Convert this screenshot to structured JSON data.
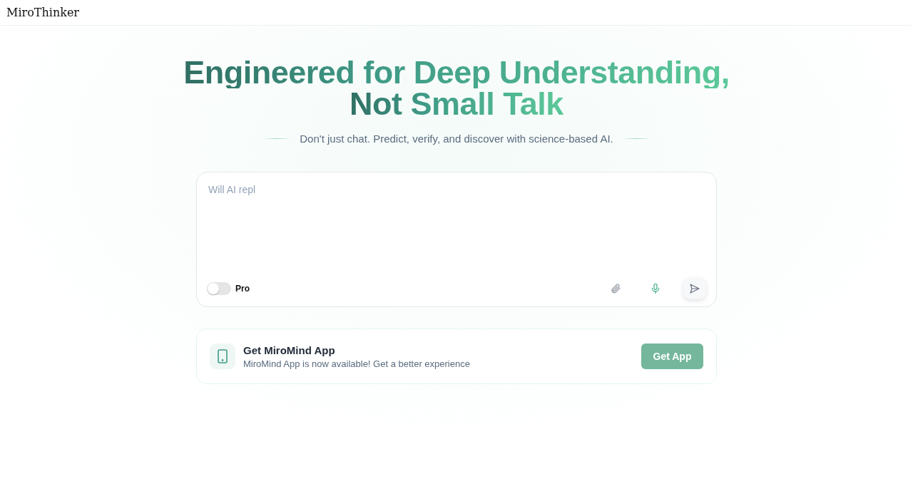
{
  "header": {
    "title": "MiroThinker"
  },
  "hero": {
    "headline_lines": [
      "Engineered for Deep Understanding,",
      "Not Small Talk"
    ],
    "subtitle": "Don't just chat. Predict, verify, and discover with science-based AI."
  },
  "composer": {
    "placeholder": "Will AI repl",
    "pro_toggle": {
      "label": "Pro",
      "on": false
    }
  },
  "app_banner": {
    "title": "Get MiroMind App",
    "description": "MiroMind App is now available! Get a better experience",
    "button": "Get App"
  }
}
